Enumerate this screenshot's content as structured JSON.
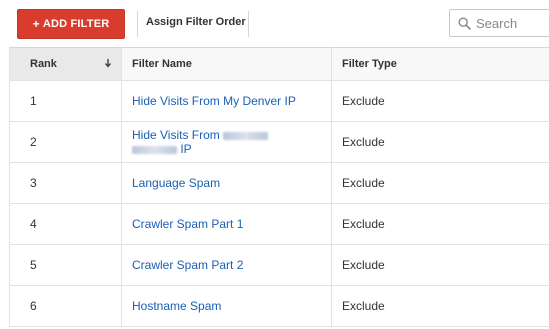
{
  "toolbar": {
    "add_filter_plus": "+",
    "add_filter_label": "ADD FILTER",
    "assign_order_label": "Assign Filter Order",
    "search_placeholder": "Search"
  },
  "table": {
    "headers": {
      "rank": "Rank",
      "filter_name": "Filter Name",
      "filter_type": "Filter Type"
    },
    "rows": [
      {
        "rank": "1",
        "name": "Hide Visits From My Denver IP",
        "type": "Exclude"
      },
      {
        "rank": "2",
        "name_start": "Hide Visits From",
        "name_end": "IP",
        "type": "Exclude"
      },
      {
        "rank": "3",
        "name": "Language Spam",
        "type": "Exclude"
      },
      {
        "rank": "4",
        "name": "Crawler Spam Part 1",
        "type": "Exclude"
      },
      {
        "rank": "5",
        "name": "Crawler Spam Part 2",
        "type": "Exclude"
      },
      {
        "rank": "6",
        "name": "Hostname Spam",
        "type": "Exclude"
      }
    ]
  },
  "colors": {
    "accent_button": "#d73c2c",
    "link": "#1a5fb4"
  },
  "icons": {
    "search": "search-icon",
    "sort": "sort-down-icon"
  }
}
